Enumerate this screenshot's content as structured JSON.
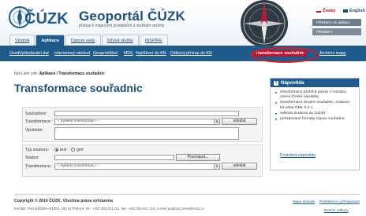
{
  "header": {
    "logo_text": "ČÚZK",
    "title": "Geoportál ČÚZK",
    "subtitle": "přístup k mapovým produktům a službám resortu",
    "lang_cz": "Česky",
    "lang_en": "English",
    "login_label": "Přihlášení do aplikací",
    "account_label": "Přihlášení"
  },
  "tabs": [
    "Věstník",
    "Aplikace",
    "Datové sady",
    "Síťové služby",
    "INSPIRE"
  ],
  "active_tab_index": 1,
  "nav": {
    "items": [
      "Úvod",
      "Vyhledávání dat",
      "Internetový obchod",
      "Geoprohlížeč",
      "MDE",
      "Nahlížení do KN",
      "Dálkový přístup do KN",
      "Transformace souřadnic",
      "Archivní mapy"
    ],
    "current_index": 7
  },
  "breadcrumb": {
    "prefix": "Nyní jste zde:",
    "path": "Aplikace / Transformace souřadnic"
  },
  "page_title": "Transformace souřadnic",
  "form1": {
    "coords_label": "Souřadnice:",
    "transform_label": "Transformace:",
    "transform_value": "-- Vyberte transformaci --",
    "result_label": "Výsledek:",
    "submit_label": "odeslat"
  },
  "form2": {
    "file_type_label": "Typ souboru:",
    "option_text": "text",
    "option_gml": "gml",
    "file_label": "Soubor:",
    "browse_label": "Procházet...",
    "transform_label": "Transformace:",
    "transform_value": "-- Vyberte transformaci --",
    "submit_label": "odeslat"
  },
  "help": {
    "title": "Nápověda",
    "items": [
      "transformace probíhá pouze v rozsahu území České republiky",
      "transformace dvojice souřadnic, souboru txt nebo GML 3.2.1",
      "velikost souboru do 1024K",
      "požadované formáty zápisu souřadnic"
    ],
    "link": "Podrobná nápověda"
  },
  "footer": {
    "copyright": "Copyright © 2010 ČÚZK, Všechna práva vyhrazena",
    "contact": "Kontakt: Pod sídlištěm 9/1800, 182 11 Praha 8, tel.: +420 284 041 111, fax: +420 284 041 416, e-mail: podpora.zums@cuzk.cz",
    "link_sitemap": "Mapa stránek",
    "link_accessibility": "Prohlášení o přístupnosti",
    "link_external": "Externí odkazy"
  },
  "colors": {
    "brand_blue": "#1f5b8d",
    "highlight_red": "#e01a1a"
  }
}
